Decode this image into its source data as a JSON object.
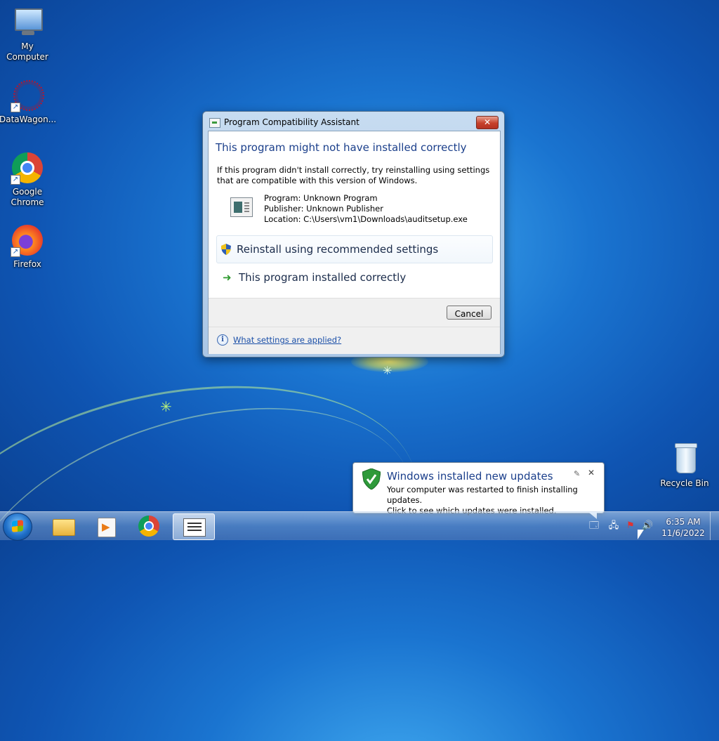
{
  "desktop": {
    "icons": [
      {
        "label": "My Computer"
      },
      {
        "label": "DataWagon..."
      },
      {
        "label": "Google Chrome"
      },
      {
        "label": "Firefox"
      },
      {
        "label": "Recycle Bin"
      }
    ]
  },
  "dialog": {
    "title": "Program Compatibility Assistant",
    "close_label": "✕",
    "heading": "This program might not have installed correctly",
    "description": "If this program didn't install correctly, try reinstalling using settings that are compatible with this version of Windows.",
    "program": "Program: Unknown Program",
    "publisher": "Publisher: Unknown Publisher",
    "location": "Location: C:\\Users\\vm1\\Downloads\\auditsetup.exe",
    "option_reinstall": "Reinstall using recommended settings",
    "option_correct": "This program installed correctly",
    "cancel_label": "Cancel",
    "help_link": "What settings are applied?"
  },
  "notification": {
    "title": "Windows installed new updates",
    "line1": "Your computer was restarted to finish installing updates.",
    "line2": "Click to see which updates were installed."
  },
  "taskbar": {
    "time": "6:35 AM",
    "date": "11/6/2022"
  }
}
